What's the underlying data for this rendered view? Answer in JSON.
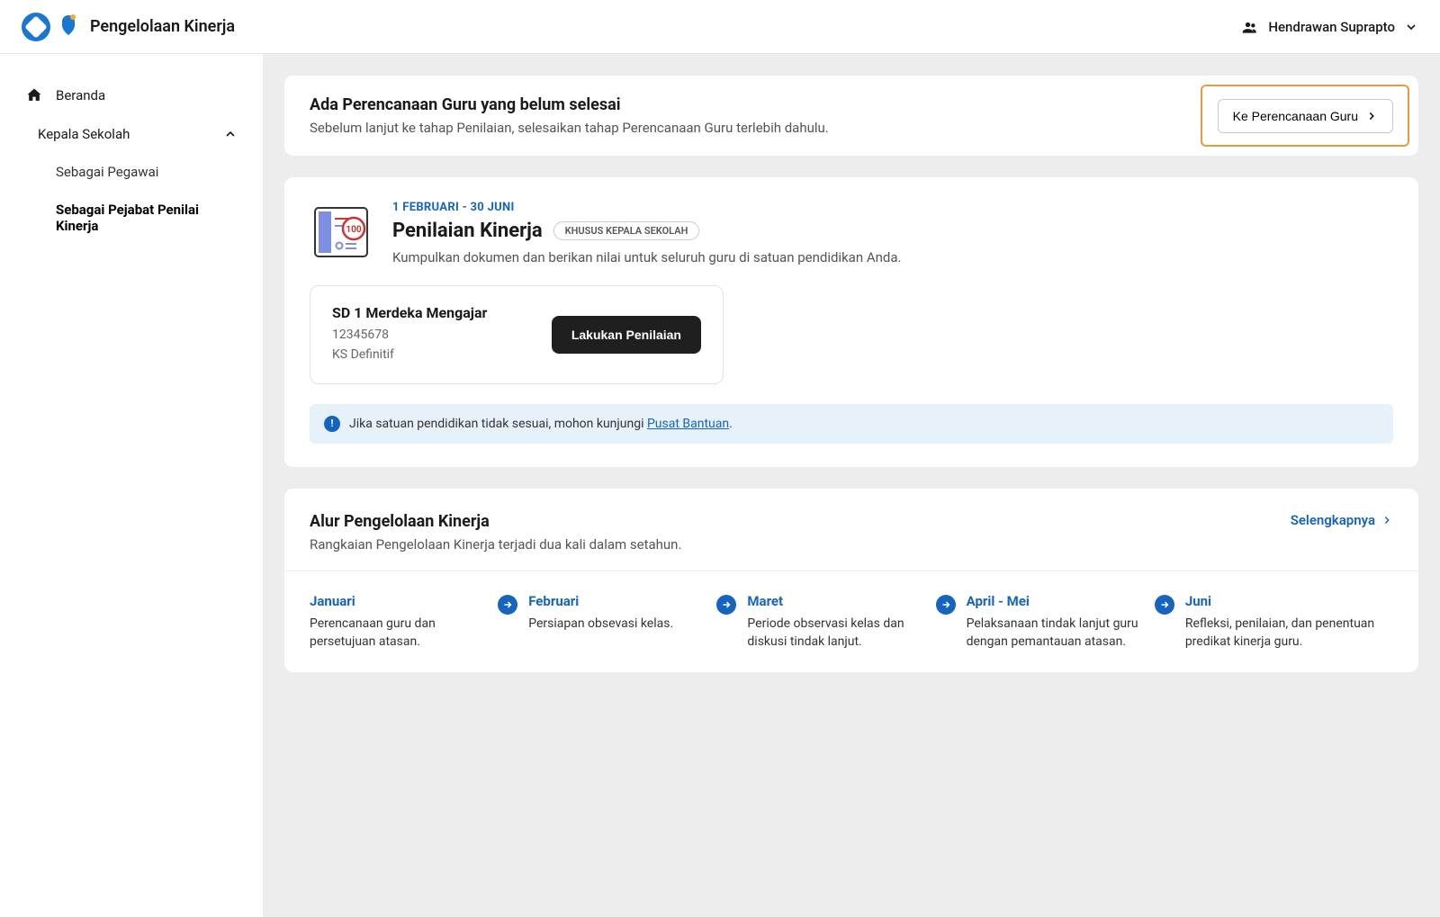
{
  "header": {
    "app_title": "Pengelolaan Kinerja",
    "username": "Hendrawan Suprapto"
  },
  "sidebar": {
    "beranda": "Beranda",
    "group_label": "Kepala Sekolah",
    "sub": [
      {
        "label": "Sebagai Pegawai"
      },
      {
        "label": "Sebagai Pejabat Penilai Kinerja"
      }
    ]
  },
  "alert": {
    "title": "Ada Perencanaan Guru yang belum selesai",
    "sub": "Sebelum lanjut ke tahap Penilaian, selesaikan tahap Perencanaan Guru terlebih dahulu.",
    "button": "Ke Perencanaan Guru"
  },
  "penilaian": {
    "date_range": "1 FEBRUARI - 30 JUNI",
    "title": "Penilaian Kinerja",
    "badge": "KHUSUS KEPALA SEKOLAH",
    "sub": "Kumpulkan dokumen dan berikan nilai untuk seluruh guru di satuan pendidikan Anda.",
    "school": {
      "name": "SD 1 Merdeka Mengajar",
      "id": "12345678",
      "role": "KS Definitif",
      "button": "Lakukan Penilaian"
    },
    "info_prefix": "Jika satuan pendidikan tidak sesuai, mohon kunjungi ",
    "info_link": "Pusat Bantuan",
    "info_suffix": "."
  },
  "alur": {
    "title": "Alur Pengelolaan Kinerja",
    "sub": "Rangkaian Pengelolaan Kinerja terjadi dua kali dalam setahun.",
    "more": "Selengkapnya",
    "items": [
      {
        "month": "Januari",
        "desc": "Perencanaan guru dan persetujuan atasan."
      },
      {
        "month": "Februari",
        "desc": "Persiapan obsevasi kelas."
      },
      {
        "month": "Maret",
        "desc": "Periode observasi kelas dan diskusi tindak lanjut."
      },
      {
        "month": "April - Mei",
        "desc": "Pelaksanaan tindak lanjut guru dengan pemantauan atasan."
      },
      {
        "month": "Juni",
        "desc": "Refleksi, penilaian, dan penentuan predikat kinerja guru."
      }
    ]
  }
}
